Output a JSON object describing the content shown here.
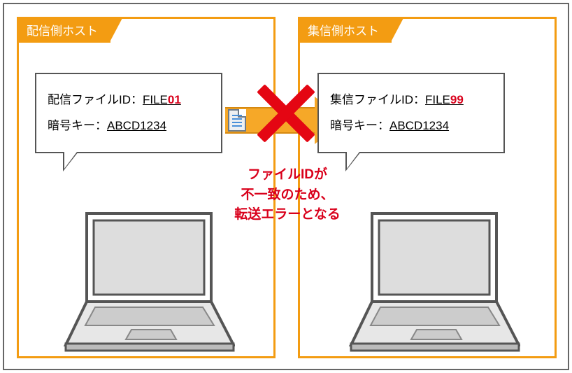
{
  "left_host": {
    "title": "配信側ホスト",
    "file_label": "配信ファイルID：",
    "file_prefix": "FILE",
    "file_suffix": "01",
    "key_label": "暗号キー：",
    "key_value": "ABCD1234"
  },
  "right_host": {
    "title": "集信側ホスト",
    "file_label": "集信ファイルID：",
    "file_prefix": "FILE",
    "file_suffix": "99",
    "key_label": "暗号キー：",
    "key_value": "ABCD1234"
  },
  "error_message": {
    "line1": "ファイルIDが",
    "line2": "不一致のため、",
    "line3": "転送エラーとなる"
  },
  "colors": {
    "accent": "#f39c12",
    "error": "#d9001b"
  }
}
